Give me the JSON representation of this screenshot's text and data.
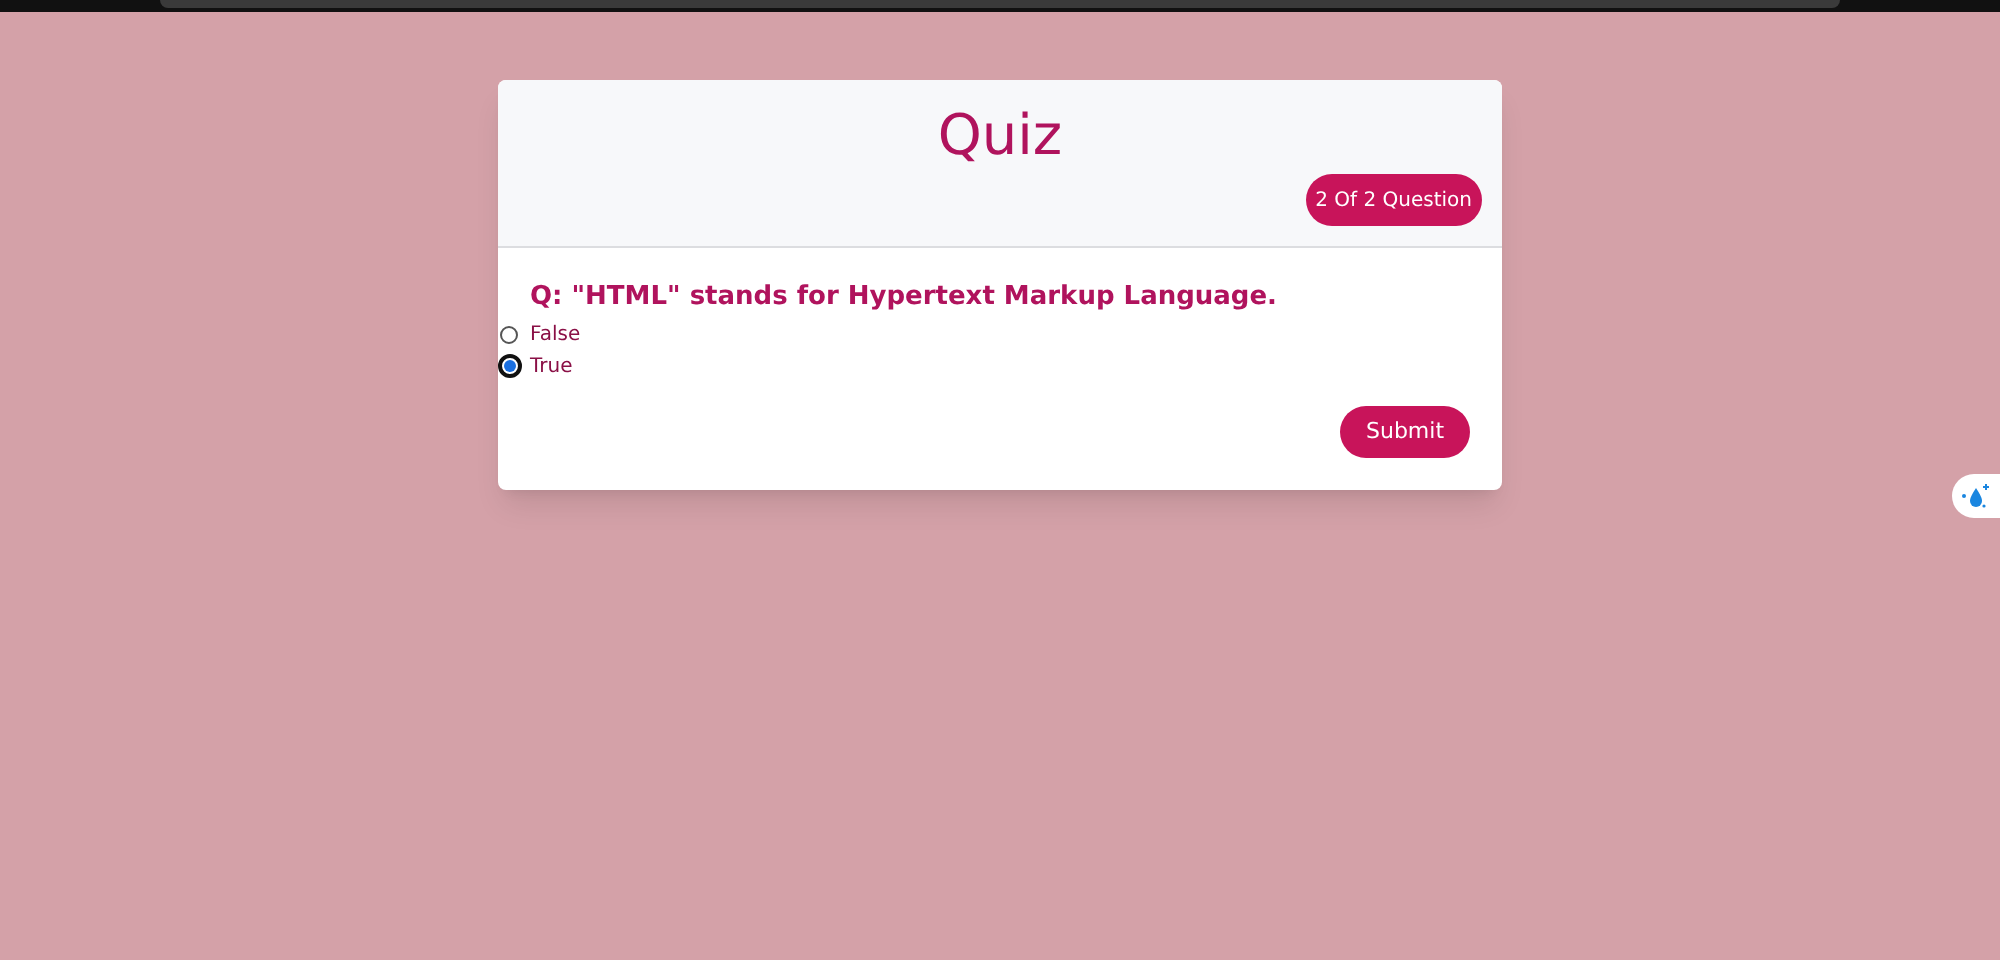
{
  "quiz": {
    "title": "Quiz",
    "progress": "2 Of 2 Question",
    "question": "Q: \"HTML\" stands for Hypertext Markup Language.",
    "options": [
      {
        "label": "False",
        "selected": false
      },
      {
        "label": "True",
        "selected": true
      }
    ],
    "submit": "Submit"
  }
}
